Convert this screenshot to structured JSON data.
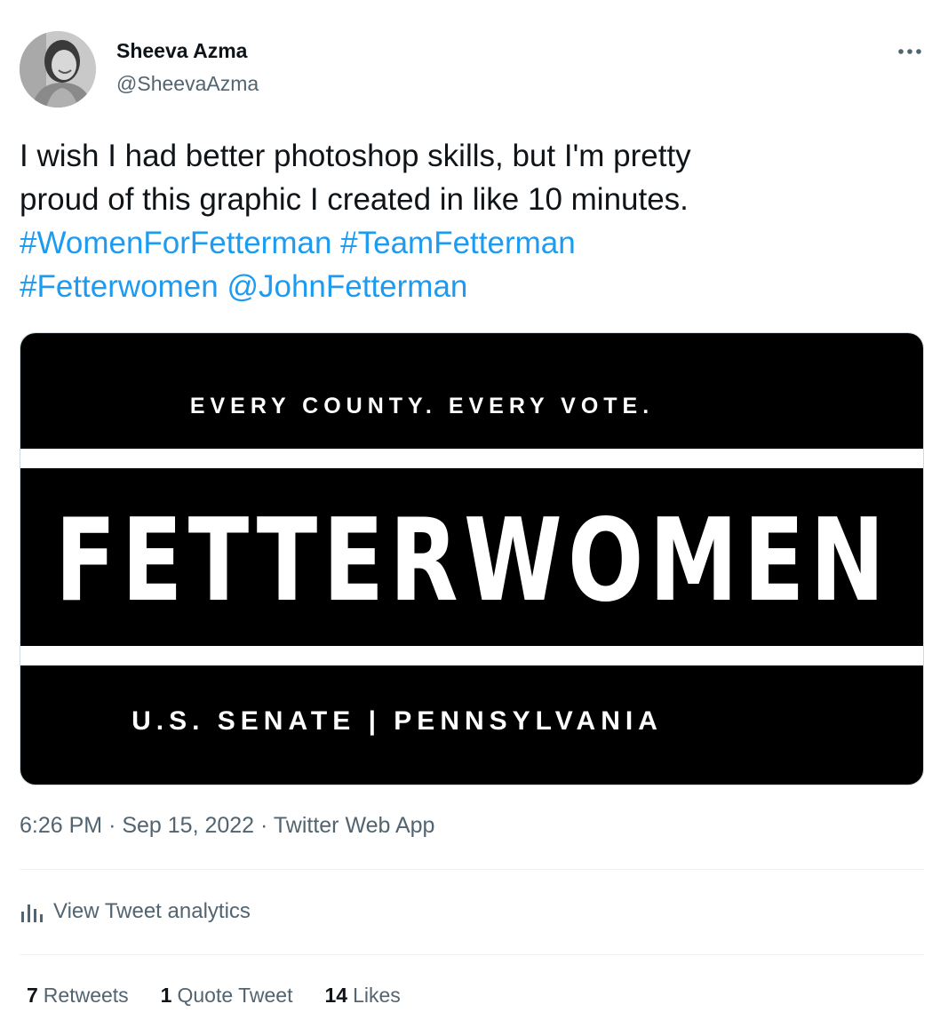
{
  "author": {
    "name": "Sheeva Azma",
    "handle": "@SheevaAzma"
  },
  "tweet": {
    "text_lines": [
      "I wish I had better photoshop skills, but I'm pretty",
      "proud of this graphic I created in like 10 minutes."
    ],
    "links": {
      "hashtag_1": "#WomenForFetterman",
      "hashtag_2": "#TeamFetterman",
      "hashtag_3": "#Fetterwomen",
      "mention": "@JohnFetterman"
    }
  },
  "media": {
    "top_text": "EVERY COUNTY. EVERY VOTE.",
    "main_text": "FETTERWOMEN",
    "bottom_text": "U.S. SENATE | PENNSYLVANIA"
  },
  "meta": {
    "time": "6:26 PM",
    "separator": "·",
    "date": "Sep 15, 2022",
    "source": "Twitter Web App"
  },
  "analytics": {
    "label": "View Tweet analytics"
  },
  "stats": {
    "retweets_count": "7",
    "retweets_label": "Retweets",
    "quotes_count": "1",
    "quotes_label": "Quote Tweet",
    "likes_count": "14",
    "likes_label": "Likes"
  },
  "colors": {
    "link": "#1d9bf0",
    "secondary_text": "#536471",
    "primary_text": "#0f1419"
  },
  "icons": {
    "more": "more-horizontal-icon",
    "analytics": "bar-chart-icon"
  }
}
